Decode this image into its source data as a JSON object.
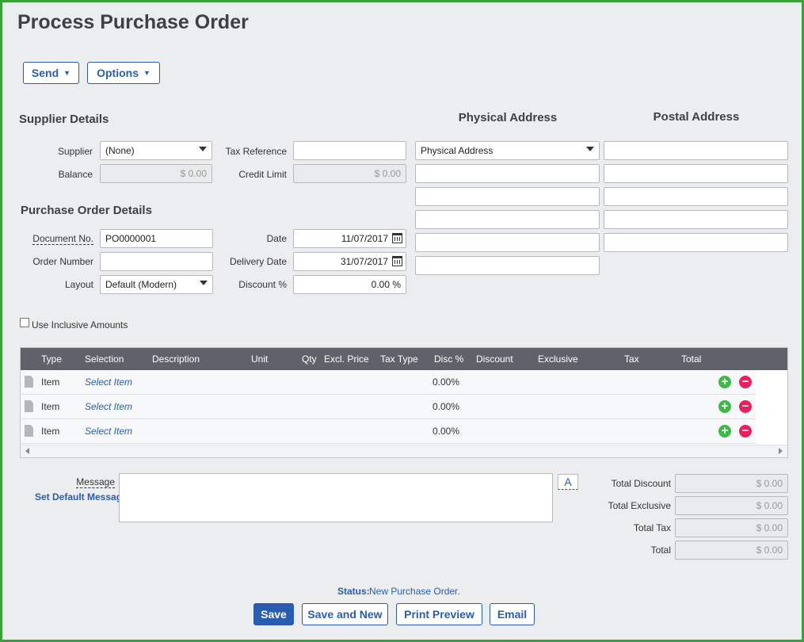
{
  "page": {
    "title": "Process Purchase Order"
  },
  "toolbar": {
    "send": "Send",
    "options": "Options"
  },
  "supplier": {
    "heading": "Supplier Details",
    "supplier_label": "Supplier",
    "supplier_value": "(None)",
    "balance_label": "Balance",
    "balance_value": "$ 0.00",
    "tax_ref_label": "Tax Reference",
    "tax_ref_value": "",
    "credit_limit_label": "Credit Limit",
    "credit_limit_value": "$ 0.00"
  },
  "addresses": {
    "physical_heading": "Physical Address",
    "postal_heading": "Postal Address",
    "physical_select": "Physical Address"
  },
  "po": {
    "heading": "Purchase Order Details",
    "doc_no_label": "Document No.",
    "doc_no_value": "PO0000001",
    "order_number_label": "Order Number",
    "order_number_value": "",
    "layout_label": "Layout",
    "layout_value": "Default (Modern)",
    "date_label": "Date",
    "date_value": "11/07/2017",
    "delivery_label": "Delivery Date",
    "delivery_value": "31/07/2017",
    "discount_label": "Discount %",
    "discount_value": "0.00 %"
  },
  "inclusive_label": "Use Inclusive Amounts",
  "grid": {
    "columns": [
      "Type",
      "Selection",
      "Description",
      "Unit",
      "Qty",
      "Excl. Price",
      "Tax Type",
      "Disc %",
      "Discount",
      "Exclusive",
      "Tax",
      "Total"
    ],
    "rows": [
      {
        "type": "Item",
        "selection": "Select Item",
        "disc": "0.00%"
      },
      {
        "type": "Item",
        "selection": "Select Item",
        "disc": "0.00%"
      },
      {
        "type": "Item",
        "selection": "Select Item",
        "disc": "0.00%"
      }
    ]
  },
  "message": {
    "label": "Message",
    "default_link": "Set Default Message",
    "format_button": "A"
  },
  "totals": {
    "discount_label": "Total Discount",
    "discount_value": "$ 0.00",
    "exclusive_label": "Total Exclusive",
    "exclusive_value": "$ 0.00",
    "tax_label": "Total Tax",
    "tax_value": "$ 0.00",
    "total_label": "Total",
    "total_value": "$ 0.00"
  },
  "status": {
    "label": "Status:",
    "value": "New Purchase Order."
  },
  "footer": {
    "save": "Save",
    "save_new": "Save and New",
    "print_preview": "Print Preview",
    "email": "Email"
  },
  "colors": {
    "accent": "#2a5db0",
    "frame": "#3aa03a",
    "grid_header": "#5f6369",
    "add": "#3fb84a",
    "remove": "#e8215e"
  }
}
